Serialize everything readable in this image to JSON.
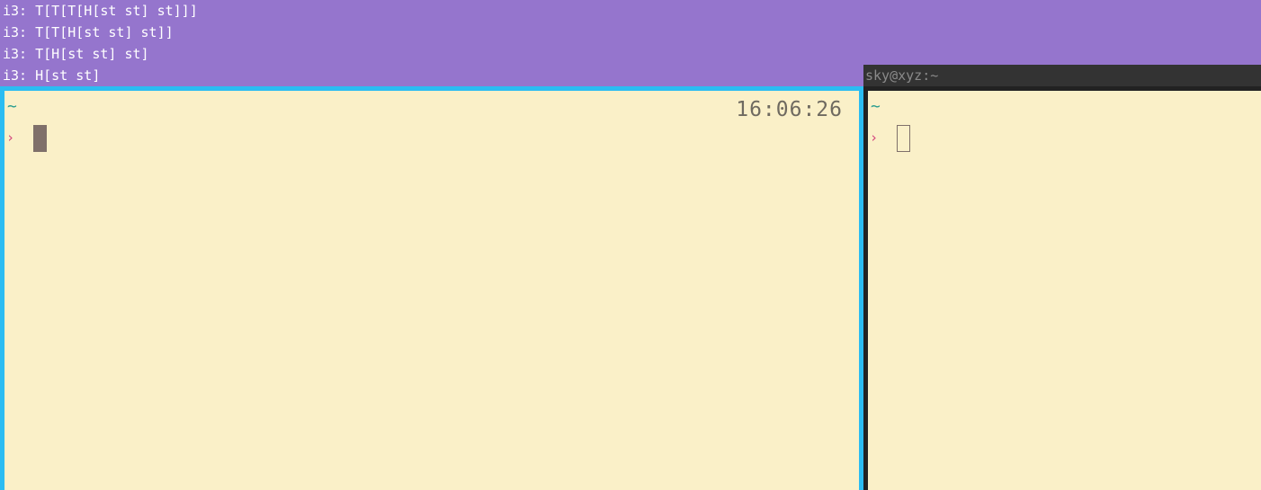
{
  "i3_bars": [
    "i3: T[T[T[H[st st] st]]]",
    "i3: T[T[H[st st] st]]",
    "i3: T[H[st st] st]",
    "i3: H[st st]"
  ],
  "left_terminal": {
    "cwd": "~",
    "prompt": "›",
    "clock": "16:06:26"
  },
  "right_terminal": {
    "title": "sky@xyz:~",
    "cwd": "~",
    "prompt": "›"
  },
  "colors": {
    "workspace_bg": "#9575cd",
    "focused_border": "#2bbcf2",
    "terminal_bg": "#faf0c8",
    "tilde": "#2a9d8f",
    "prompt": "#d3427d"
  }
}
